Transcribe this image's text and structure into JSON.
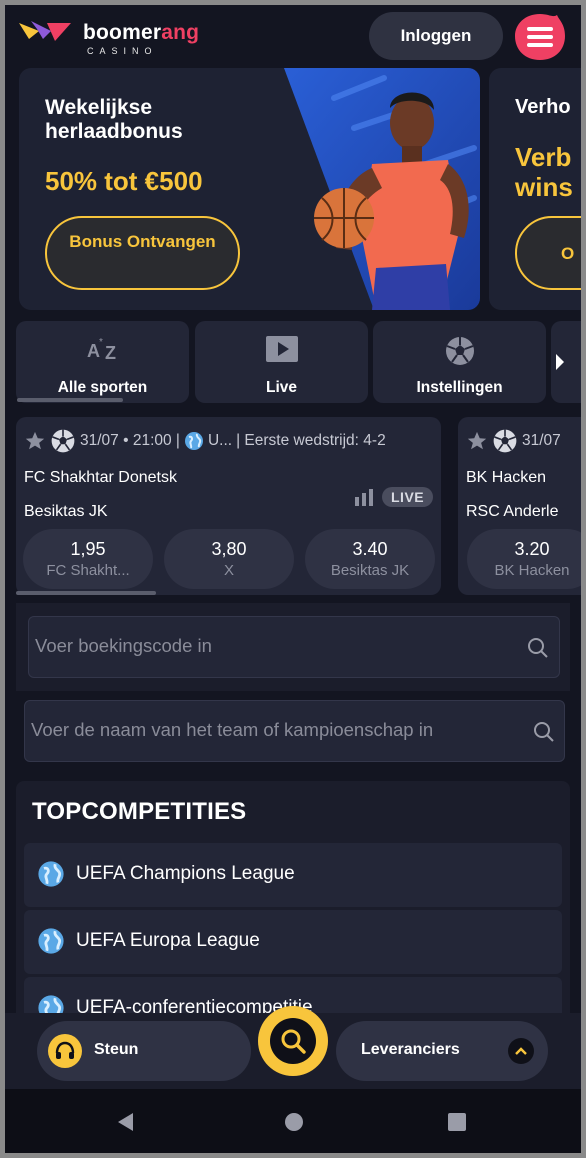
{
  "header": {
    "logo_word_main": "boomer",
    "logo_word_accent": "ang",
    "logo_sub": "CASINO",
    "login_label": "Inloggen",
    "menu_icon": "hamburger-menu-icon"
  },
  "banners": [
    {
      "title": "Wekelijkse herlaadbonus",
      "promo": "50% tot €500",
      "cta": "Bonus Ontvangen"
    },
    {
      "title": "Verho",
      "promo_line1": "Verb",
      "promo_line2": "wins",
      "cta": "O"
    }
  ],
  "sport_tabs": [
    {
      "label": "Alle sporten",
      "icon": "a-z-sort-icon"
    },
    {
      "label": "Live",
      "icon": "play-icon"
    },
    {
      "label": "Instellingen",
      "icon": "soccer-ball-icon"
    }
  ],
  "matches": [
    {
      "datetime": "31/07 • 21:00 |",
      "league": "U...",
      "first_match": "| Eerste wedstrijd: 4-2",
      "team_a": "FC Shakhtar Donetsk",
      "team_b": "Besiktas JK",
      "live_label": "LIVE",
      "odds": [
        {
          "value": "1,95",
          "label": "FC Shakht..."
        },
        {
          "value": "3,80",
          "label": "X"
        },
        {
          "value": "3.40",
          "label": "Besiktas JK"
        }
      ]
    },
    {
      "datetime": "31/07",
      "team_a": "BK Hacken",
      "team_b": "RSC Anderle",
      "odds": [
        {
          "value": "3.20",
          "label": "BK Hacken"
        }
      ]
    }
  ],
  "search": {
    "booking_placeholder": "Voer boekingscode in",
    "team_placeholder": "Voer de naam van het team of kampioenschap in"
  },
  "top_competitions": {
    "title": "TOPCOMPETITIES",
    "items": [
      {
        "name": "UEFA Champions League"
      },
      {
        "name": "UEFA Europa League"
      },
      {
        "name": "UEFA-conferentiecompetitie"
      }
    ]
  },
  "bottom_bar": {
    "support_label": "Steun",
    "providers_label": "Leveranciers"
  },
  "colors": {
    "background": "#131521",
    "card": "#232637",
    "accent_yellow": "#f8c53c",
    "brand_red": "#ef4063"
  }
}
